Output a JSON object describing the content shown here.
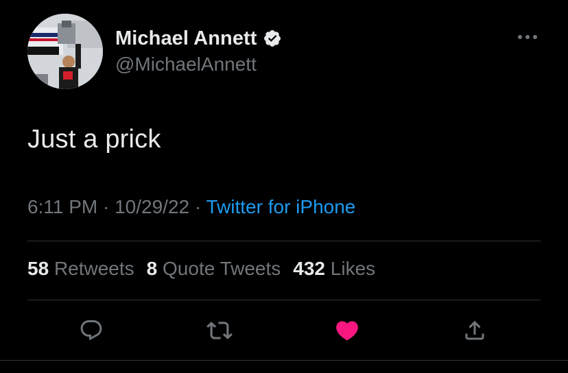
{
  "author": {
    "display_name": "Michael Annett",
    "handle": "@MichaelAnnett",
    "verified": true,
    "avatar_icon": "avatar-icon"
  },
  "tweet": {
    "text": "Just a prick"
  },
  "meta": {
    "time": "6:11 PM",
    "separator": "·",
    "date": "10/29/22",
    "source": "Twitter for iPhone"
  },
  "stats": {
    "retweets_count": "58",
    "retweets_label": "Retweets",
    "quotes_count": "8",
    "quotes_label": "Quote Tweets",
    "likes_count": "432",
    "likes_label": "Likes"
  },
  "actions": [
    {
      "name": "reply",
      "icon": "reply-icon"
    },
    {
      "name": "retweet",
      "icon": "retweet-icon"
    },
    {
      "name": "like",
      "icon": "heart-icon",
      "active": true
    },
    {
      "name": "share",
      "icon": "share-icon"
    }
  ],
  "colors": {
    "background": "#000000",
    "primary_text": "#e7e9ea",
    "secondary_text": "#71767b",
    "link": "#1d9bf0",
    "like_active": "#f91880",
    "divider": "#2f3336",
    "verified_badge": "#e7e9ea"
  }
}
